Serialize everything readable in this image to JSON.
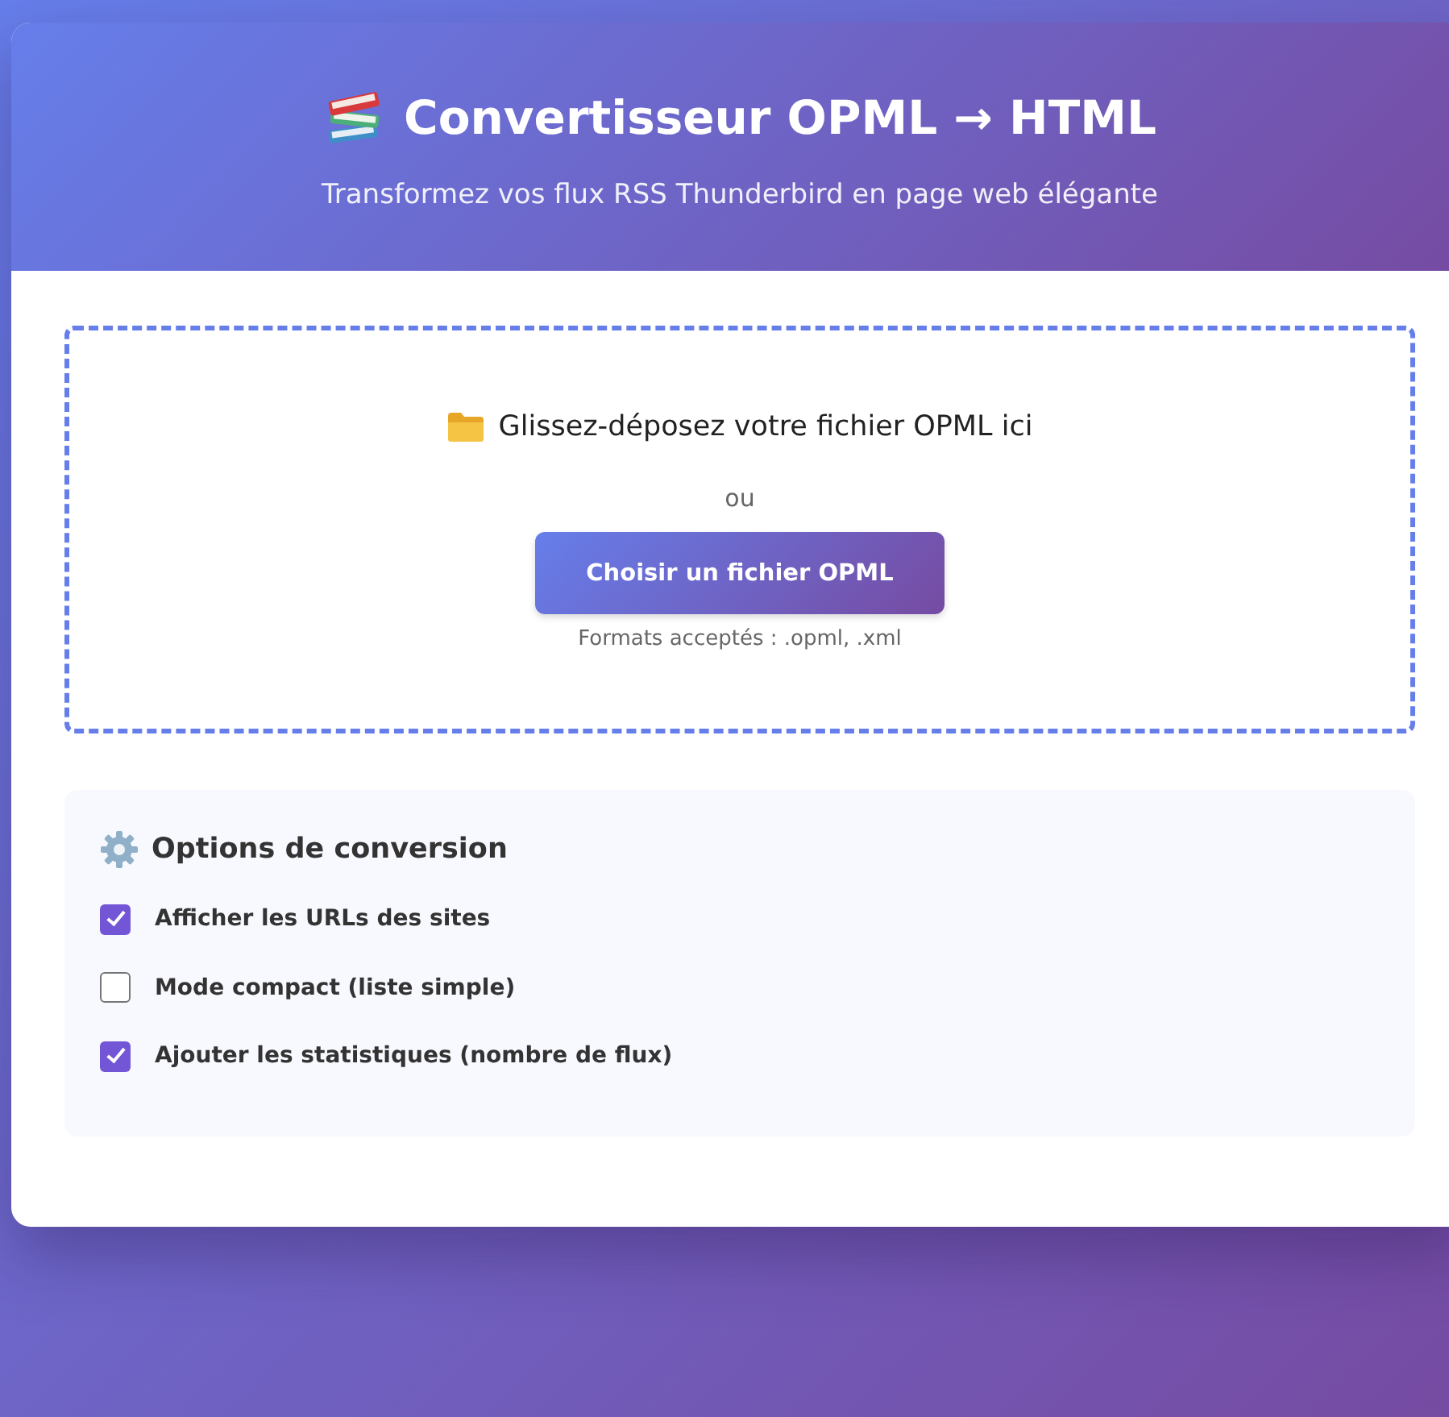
{
  "header": {
    "title": "Convertisseur OPML → HTML",
    "subtitle": "Transformez vos flux RSS Thunderbird en page web élégante"
  },
  "dropzone": {
    "prompt": "Glissez-déposez votre fichier OPML ici",
    "separator": "ou",
    "button": "Choisir un fichier OPML",
    "formats": "Formats acceptés : .opml, .xml"
  },
  "options": {
    "title": "Options de conversion",
    "items": [
      {
        "label": "Afficher les URLs des sites",
        "checked": true
      },
      {
        "label": "Mode compact (liste simple)",
        "checked": false
      },
      {
        "label": "Ajouter les statistiques (nombre de flux)",
        "checked": true
      }
    ]
  }
}
